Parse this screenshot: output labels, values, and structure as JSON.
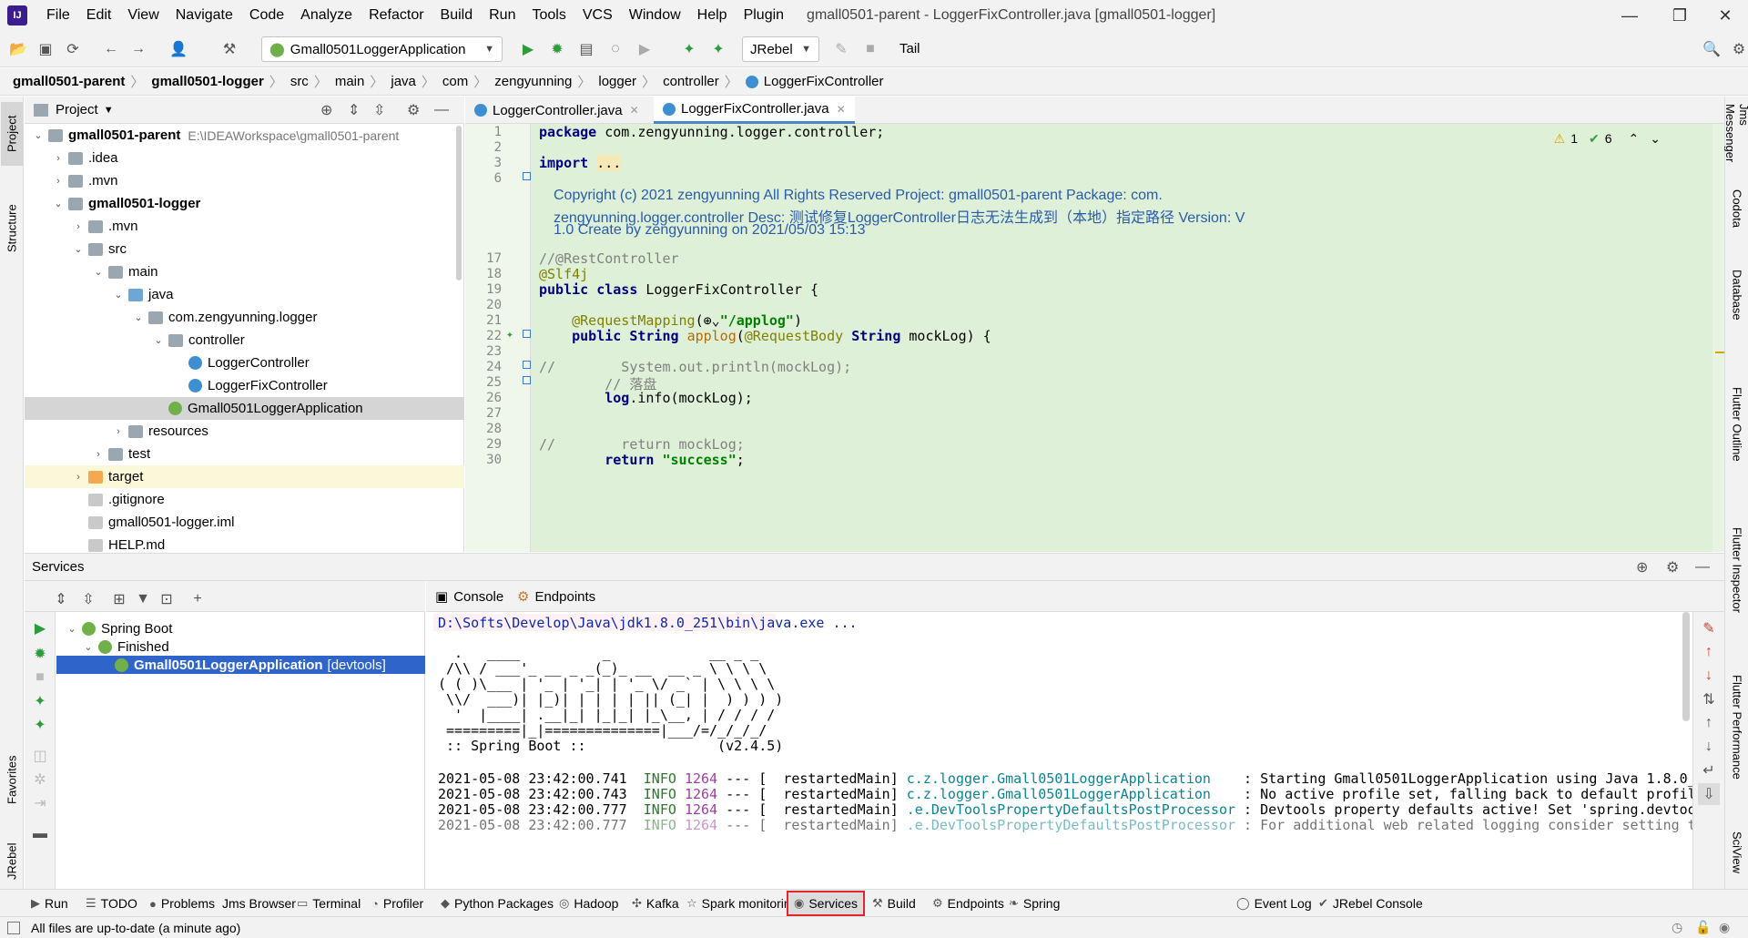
{
  "window": {
    "title": "gmall0501-parent - LoggerFixController.java [gmall0501-logger]"
  },
  "menu": [
    "File",
    "Edit",
    "View",
    "Navigate",
    "Code",
    "Analyze",
    "Refactor",
    "Build",
    "Run",
    "Tools",
    "VCS",
    "Window",
    "Help",
    "Plugin"
  ],
  "toolbar": {
    "run_config": "Gmall0501LoggerApplication",
    "jrebel": "JRebel",
    "tail": "Tail"
  },
  "breadcrumbs": [
    "gmall0501-parent",
    "gmall0501-logger",
    "src",
    "main",
    "java",
    "com",
    "zengyunning",
    "logger",
    "controller",
    "LoggerFixController"
  ],
  "left_tabs": {
    "project": "Project",
    "structure": "Structure",
    "favorites": "Favorites",
    "jrebel": "JRebel"
  },
  "right_tabs": [
    "Jms Messenger",
    "Codota",
    "Database",
    "Flutter Outline",
    "Flutter Inspector",
    "Flutter Performance",
    "SciView"
  ],
  "project": {
    "header": "Project",
    "tree": [
      {
        "label": "gmall0501-parent",
        "path": "E:\\IDEAWorkspace\\gmall0501-parent",
        "indent": 0,
        "tw": "v",
        "icon": "fold",
        "bold": true
      },
      {
        "label": ".idea",
        "indent": 1,
        "tw": ">",
        "icon": "fold"
      },
      {
        "label": ".mvn",
        "indent": 1,
        "tw": ">",
        "icon": "fold"
      },
      {
        "label": "gmall0501-logger",
        "indent": 1,
        "tw": "v",
        "icon": "fold",
        "bold": true
      },
      {
        "label": ".mvn",
        "indent": 2,
        "tw": ">",
        "icon": "fold"
      },
      {
        "label": "src",
        "indent": 2,
        "tw": "v",
        "icon": "fold"
      },
      {
        "label": "main",
        "indent": 3,
        "tw": "v",
        "icon": "fold"
      },
      {
        "label": "java",
        "indent": 4,
        "tw": "v",
        "icon": "fold-src"
      },
      {
        "label": "com.zengyunning.logger",
        "indent": 5,
        "tw": "v",
        "icon": "fold"
      },
      {
        "label": "controller",
        "indent": 6,
        "tw": "v",
        "icon": "fold"
      },
      {
        "label": "LoggerController",
        "indent": 7,
        "tw": "",
        "icon": "cls"
      },
      {
        "label": "LoggerFixController",
        "indent": 7,
        "tw": "",
        "icon": "cls"
      },
      {
        "label": "Gmall0501LoggerApplication",
        "indent": 6,
        "tw": "",
        "icon": "app",
        "selected": true
      },
      {
        "label": "resources",
        "indent": 4,
        "tw": ">",
        "icon": "fold"
      },
      {
        "label": "test",
        "indent": 3,
        "tw": ">",
        "icon": "fold"
      },
      {
        "label": "target",
        "indent": 2,
        "tw": ">",
        "icon": "fold-org",
        "highlight": true
      },
      {
        "label": ".gitignore",
        "indent": 2,
        "tw": "",
        "icon": "file"
      },
      {
        "label": "gmall0501-logger.iml",
        "indent": 2,
        "tw": "",
        "icon": "file"
      },
      {
        "label": "HELP.md",
        "indent": 2,
        "tw": "",
        "icon": "file"
      }
    ]
  },
  "editor": {
    "tabs": [
      "LoggerController.java",
      "LoggerFixController.java"
    ],
    "warnings": "1",
    "checks": "6",
    "lines": [
      {
        "n": "1",
        "html": "<span class='kw'>package</span> com.zengyunning.logger.controller;"
      },
      {
        "n": "2",
        "html": ""
      },
      {
        "n": "3",
        "html": "<span class='kw'>import</span> <span style='background:#f5e9b8'>...</span>"
      },
      {
        "n": "6",
        "html": ""
      },
      {
        "n": "17",
        "html": "<span class='cm'>//@RestController</span>"
      },
      {
        "n": "18",
        "html": "<span class='an'>@Slf4j</span>"
      },
      {
        "n": "19",
        "html": "<span class='kw'>public class</span> LoggerFixController {"
      },
      {
        "n": "20",
        "html": ""
      },
      {
        "n": "21",
        "html": "    <span class='an'>@RequestMapping</span>(⊕⌄<span class='st'>\"/applog\"</span>)"
      },
      {
        "n": "22",
        "html": "    <span class='kw'>public</span> <span class='kw'>String</span> <span style='color:#b86a00'>applog</span>(<span class='an'>@RequestBody</span> <span class='kw'>String</span> mockLog) {"
      },
      {
        "n": "23",
        "html": ""
      },
      {
        "n": "24",
        "html": "<span class='cm'>//        System.out.println(mockLog);</span>"
      },
      {
        "n": "25",
        "html": "        <span class='cm'>// 落盘</span>"
      },
      {
        "n": "26",
        "html": "        <span class='kw'>log</span>.info(mockLog);"
      },
      {
        "n": "27",
        "html": ""
      },
      {
        "n": "28",
        "html": ""
      },
      {
        "n": "29",
        "html": "<span class='cm'>//        return mockLog;</span>"
      },
      {
        "n": "30",
        "html": "        <span class='kw'>return</span> <span class='st'>\"success\"</span>;"
      }
    ],
    "doc": [
      "Copyright (c) 2021 zengyunning All Rights Reserved Project: gmall0501-parent Package: com.",
      "zengyunning.logger.controller Desc: 测试修复LoggerController日志无法生成到（本地）指定路径 Version: V",
      "1.0 Create by zengyunning on 2021/05/03 15:13"
    ]
  },
  "services": {
    "header": "Services",
    "tree": [
      {
        "label": "Spring Boot",
        "indent": 0
      },
      {
        "label": "Finished",
        "indent": 1
      },
      {
        "label": "Gmall0501LoggerApplication",
        "suffix": "[devtools]",
        "indent": 2,
        "selected": true
      }
    ],
    "console_tabs": [
      "Console",
      "Endpoints"
    ]
  },
  "console": {
    "cmd": "D:\\Softs\\Develop\\Java\\jdk1.8.0_251\\bin\\java.exe ...",
    "banner": [
      "  .   ____          _            __ _ _",
      " /\\\\ / ___'_ __ _ _(_)_ __  __ _ \\ \\ \\ \\",
      "( ( )\\___ | '_ | '_| | '_ \\/ _` | \\ \\ \\ \\",
      " \\\\/  ___)| |_)| | | | | || (_| |  ) ) ) )",
      "  '  |____| .__|_| |_|_| |_\\__, | / / / /",
      " =========|_|==============|___/=/_/_/_/",
      " :: Spring Boot ::                (v2.4.5)"
    ],
    "logs": [
      {
        "ts": "2021-05-08 23:42:00.741",
        "level": "INFO",
        "pid": "1264",
        "sep": "---",
        "thread": "[  restartedMain]",
        "logger": "c.z.logger.Gmall0501LoggerApplication   ",
        "msg": ": Starting Gmall0501LoggerApplication using Java 1.8.0_"
      },
      {
        "ts": "2021-05-08 23:42:00.743",
        "level": "INFO",
        "pid": "1264",
        "sep": "---",
        "thread": "[  restartedMain]",
        "logger": "c.z.logger.Gmall0501LoggerApplication   ",
        "msg": ": No active profile set, falling back to default profil"
      },
      {
        "ts": "2021-05-08 23:42:00.777",
        "level": "INFO",
        "pid": "1264",
        "sep": "---",
        "thread": "[  restartedMain]",
        "logger": ".e.DevToolsPropertyDefaultsPostProcessor",
        "msg": ": Devtools property defaults active! Set 'spring.devtoo"
      },
      {
        "ts": "2021-05-08 23:42:00.777",
        "level": "INFO",
        "pid": "1264",
        "sep": "---",
        "thread": "[  restartedMain]",
        "logger": ".e.DevToolsPropertyDefaultsPostProcessor",
        "msg": ": For additional web related logging consider setting t"
      }
    ]
  },
  "bottom_tabs": [
    {
      "label": "Run",
      "icon": "▶"
    },
    {
      "label": "TODO",
      "icon": "☰"
    },
    {
      "label": "Problems",
      "icon": "●"
    },
    {
      "label": "Jms Browser",
      "icon": ""
    },
    {
      "label": "Terminal",
      "icon": "▭"
    },
    {
      "label": "Profiler",
      "icon": "◔"
    },
    {
      "label": "Python Packages",
      "icon": "◆"
    },
    {
      "label": "Hadoop",
      "icon": "◎"
    },
    {
      "label": "Kafka",
      "icon": "✣"
    },
    {
      "label": "Spark monitoring",
      "icon": "☆"
    },
    {
      "label": "Services",
      "icon": "◉",
      "active": true
    },
    {
      "label": "Build",
      "icon": "⚒"
    },
    {
      "label": "Endpoints",
      "icon": "⚙"
    },
    {
      "label": "Spring",
      "icon": "❧"
    }
  ],
  "bottom_right_tabs": [
    {
      "label": "Event Log",
      "icon": "◯"
    },
    {
      "label": "JRebel Console",
      "icon": "✔"
    }
  ],
  "status": {
    "text": "All files are up-to-date (a minute ago)"
  },
  "colors": {
    "active_tab_outline": "#e0262e",
    "selection": "#2f65ca",
    "editor_bg": "#dff0d8"
  }
}
